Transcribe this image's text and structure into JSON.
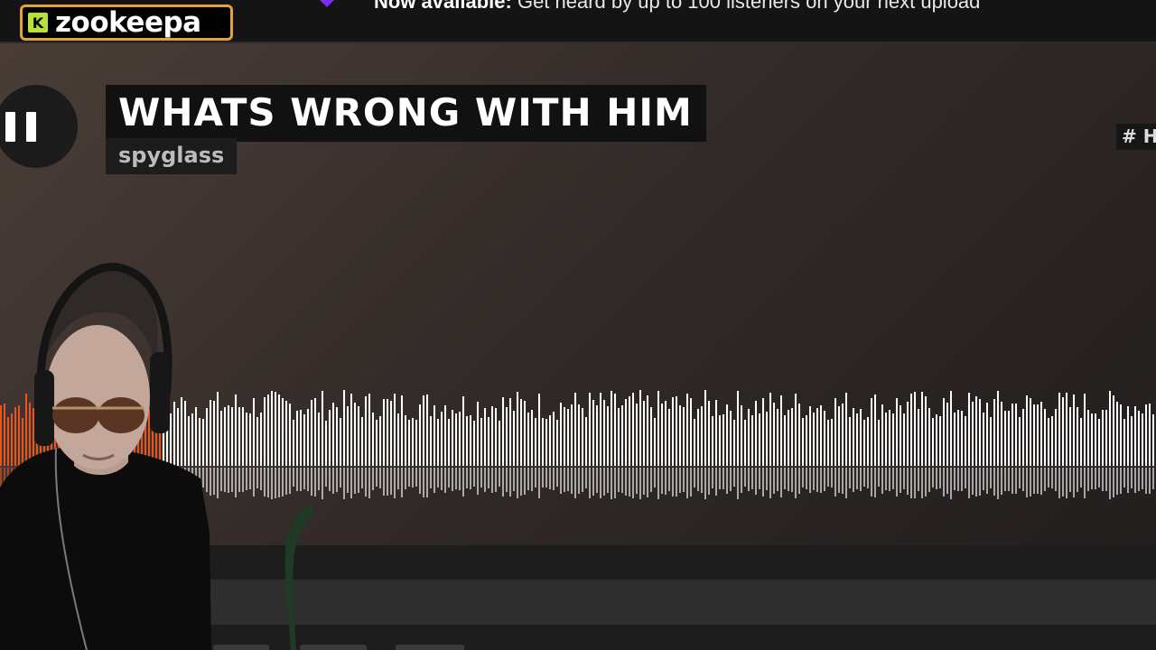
{
  "topbar": {
    "logo": {
      "badge_letter": "K",
      "text": "zookeepa",
      "border_color": "#e2a33c",
      "badge_color": "#b8e23a"
    },
    "banner": {
      "icon": "purple-promo-icon",
      "bold": "Now available:",
      "text": " Get heard by up to 100 listeners on your next upload"
    }
  },
  "player": {
    "state": "playing",
    "pause_icon": "pause-icon",
    "title": "WHATS WRONG WITH HIM",
    "artist": "spyglass",
    "hashtag": "# H",
    "waveform": {
      "played_color": "#e8531e",
      "unplayed_color": "#ffffff",
      "played_fraction": 0.14
    }
  },
  "overlay": {
    "webcam": "streamer-webcam"
  }
}
